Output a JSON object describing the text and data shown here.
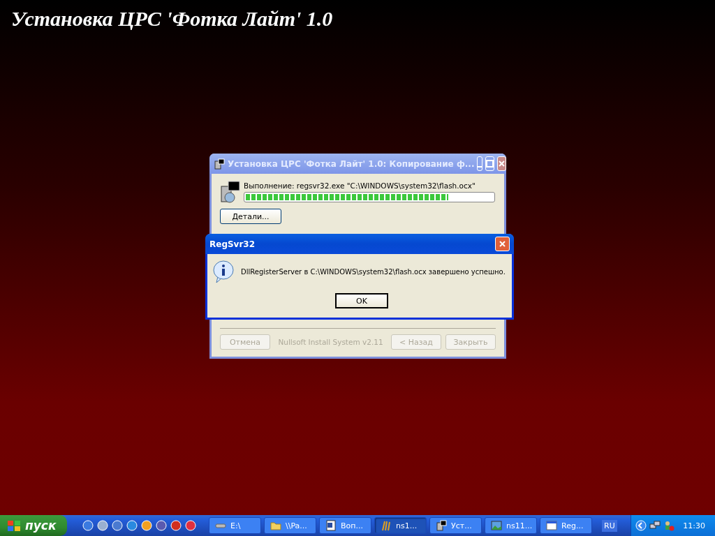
{
  "desktop": {
    "title": "Установка ЦРС 'Фотка Лайт' 1.0"
  },
  "installer": {
    "title": "Установка ЦРС 'Фотка Лайт' 1.0: Копирование ф...",
    "status": "Выполнение: regsvr32.exe \"C:\\WINDOWS\\system32\\flash.ocx\"",
    "progress": {
      "level": 0.82
    },
    "details_button": "Детали...",
    "footer": {
      "brand": "Nullsoft Install System v2.11",
      "buttons": [
        {
          "label": "Отмена",
          "disabled": true
        },
        {
          "label": "< Назад",
          "disabled": true
        },
        {
          "label": "Закрыть",
          "disabled": true
        }
      ]
    }
  },
  "dialog": {
    "title": "RegSvr32",
    "message": "DllRegisterServer в C:\\WINDOWS\\system32\\flash.ocx завершено успешно.",
    "button": "OK"
  },
  "taskbar": {
    "start": "пуск",
    "tasks": [
      {
        "label": "E:\\",
        "kind": "drive",
        "selected": false
      },
      {
        "label": "\\\\Pa...",
        "kind": "folder",
        "selected": false
      },
      {
        "label": "Воп...",
        "kind": "doc",
        "selected": false
      },
      {
        "label": "ns1...",
        "kind": "paint",
        "selected": true
      },
      {
        "label": "Уст...",
        "kind": "setup",
        "selected": false
      },
      {
        "label": "ns11...",
        "kind": "image",
        "selected": false
      },
      {
        "label": "Reg...",
        "kind": "window",
        "selected": false
      }
    ],
    "language": "RU",
    "clock": "11:30"
  }
}
